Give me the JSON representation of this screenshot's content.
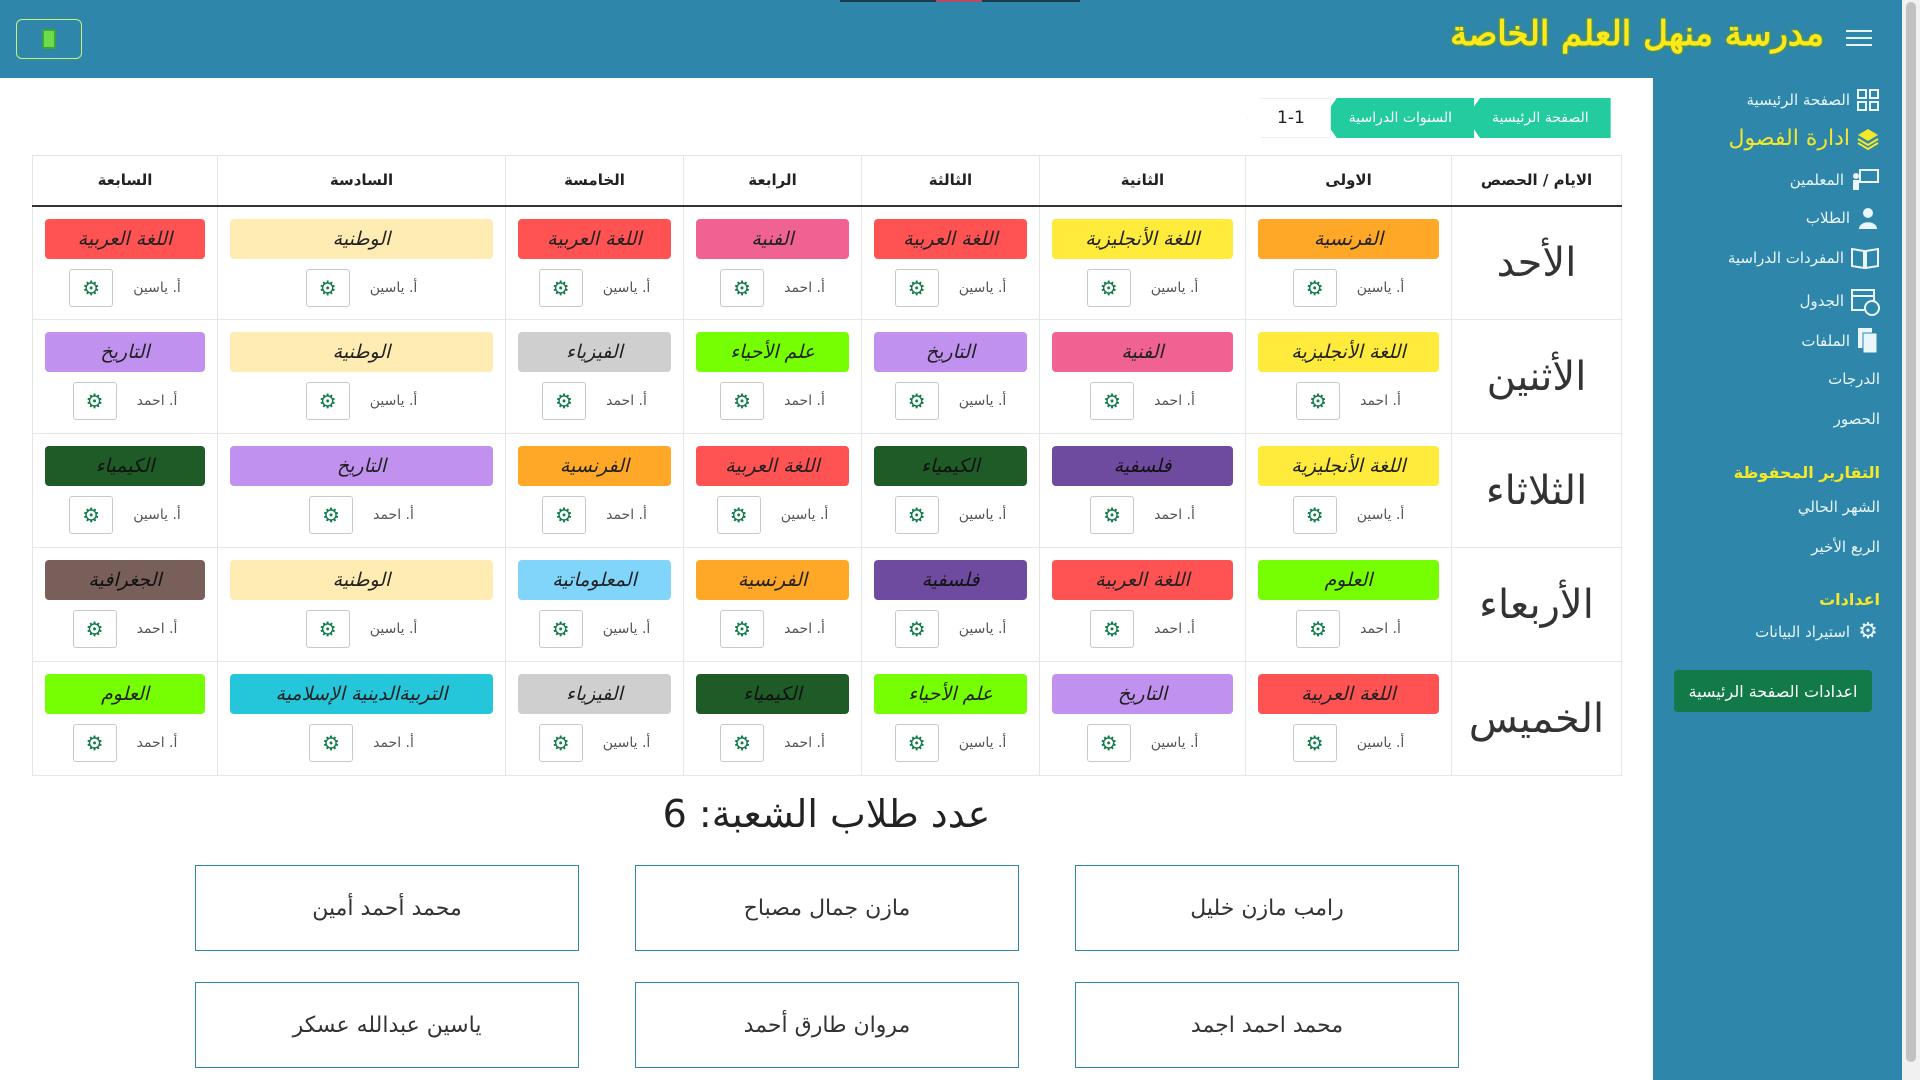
{
  "header": {
    "school_name": "مدرسة منهل العلم الخاصة",
    "exit_icon": "door-exit-icon",
    "menu_icon": "hamburger-icon"
  },
  "sidebar": {
    "items": [
      {
        "label": "الصفحة الرئيسية",
        "icon": "dashboard-icon"
      },
      {
        "label": "ادارة الفصول",
        "icon": "layers-icon"
      },
      {
        "label": "المعلمين",
        "icon": "teacher-icon"
      },
      {
        "label": "الطلاب",
        "icon": "student-icon"
      },
      {
        "label": "المفردات الدراسية",
        "icon": "book-icon"
      },
      {
        "label": "الجدول",
        "icon": "calendar-icon"
      },
      {
        "label": "الملفات",
        "icon": "files-icon"
      },
      {
        "label": "الدرجات",
        "icon": ""
      },
      {
        "label": "الحصور",
        "icon": ""
      }
    ],
    "reports_heading": "التقارير المحفوظة",
    "reports": [
      "الشهر الحالي",
      "الربع الأخير"
    ],
    "settings_heading": "اعدادات",
    "import_label": "استيراد البيانات",
    "home_settings_button": "اعدادات الصفحة الرئيسية"
  },
  "breadcrumb": [
    "الصفحة الرئيسية",
    "السنوات الدراسية",
    "1-1"
  ],
  "table": {
    "corner": "الايام / الحصص",
    "periods": [
      "الاولى",
      "الثانية",
      "الثالثة",
      "الرابعة",
      "الخامسة",
      "السادسة",
      "السابعة"
    ],
    "days": [
      {
        "name": "الأحد",
        "cells": [
          {
            "subject": "الفرنسية",
            "color": "#ffa726",
            "teacher": "أ. ياسين"
          },
          {
            "subject": "اللغة الأنجليزية",
            "color": "#ffeb3b",
            "teacher": "أ. ياسين"
          },
          {
            "subject": "اللغة العربية",
            "color": "#ff5252",
            "teacher": "أ. ياسين"
          },
          {
            "subject": "الفنية",
            "color": "#f06292",
            "teacher": "أ. احمد"
          },
          {
            "subject": "اللغة العربية",
            "color": "#ff5252",
            "teacher": "أ. ياسين"
          },
          {
            "subject": "الوطنية",
            "color": "#ffecb3",
            "teacher": "أ. ياسين"
          },
          {
            "subject": "اللغة العربية",
            "color": "#ff5252",
            "teacher": "أ. ياسين"
          }
        ]
      },
      {
        "name": "الأثنين",
        "cells": [
          {
            "subject": "اللغة الأنجليزية",
            "color": "#ffeb3b",
            "teacher": "أ. احمد"
          },
          {
            "subject": "الفنية",
            "color": "#f06292",
            "teacher": "أ. احمد"
          },
          {
            "subject": "التاريخ",
            "color": "#c191f0",
            "teacher": "أ. ياسين"
          },
          {
            "subject": "علم الأحياء",
            "color": "#76ff03",
            "teacher": "أ. احمد"
          },
          {
            "subject": "الفيزياء",
            "color": "#cfcfcf",
            "teacher": "أ. احمد"
          },
          {
            "subject": "الوطنية",
            "color": "#ffecb3",
            "teacher": "أ. ياسين"
          },
          {
            "subject": "التاريخ",
            "color": "#c191f0",
            "teacher": "أ. احمد"
          }
        ]
      },
      {
        "name": "الثلاثاء",
        "cells": [
          {
            "subject": "اللغة الأنجليزية",
            "color": "#ffeb3b",
            "teacher": "أ. ياسين"
          },
          {
            "subject": "فلسفية",
            "color": "#6f4ba0",
            "teacher": "أ. احمد"
          },
          {
            "subject": "الكيمياء",
            "color": "#1e5b26",
            "teacher": "أ. ياسين"
          },
          {
            "subject": "اللغة العربية",
            "color": "#ff5252",
            "teacher": "أ. ياسين"
          },
          {
            "subject": "الفرنسية",
            "color": "#ffa726",
            "teacher": "أ. احمد"
          },
          {
            "subject": "التاريخ",
            "color": "#c191f0",
            "teacher": "أ. احمد"
          },
          {
            "subject": "الكيمياء",
            "color": "#1e5b26",
            "teacher": "أ. ياسين"
          }
        ]
      },
      {
        "name": "الأربعاء",
        "cells": [
          {
            "subject": "العلوم",
            "color": "#76ff03",
            "teacher": "أ. احمد"
          },
          {
            "subject": "اللغة العربية",
            "color": "#ff5252",
            "teacher": "أ. احمد"
          },
          {
            "subject": "فلسفية",
            "color": "#6f4ba0",
            "teacher": "أ. ياسين"
          },
          {
            "subject": "الفرنسية",
            "color": "#ffa726",
            "teacher": "أ. احمد"
          },
          {
            "subject": "المعلوماتية",
            "color": "#81d4fa",
            "teacher": "أ. ياسين"
          },
          {
            "subject": "الوطنية",
            "color": "#ffecb3",
            "teacher": "أ. ياسين"
          },
          {
            "subject": "الجغرافية",
            "color": "#795f5a",
            "teacher": "أ. احمد"
          }
        ]
      },
      {
        "name": "الخميس",
        "cells": [
          {
            "subject": "اللغة العربية",
            "color": "#ff5252",
            "teacher": "أ. ياسين"
          },
          {
            "subject": "التاريخ",
            "color": "#c191f0",
            "teacher": "أ. ياسين"
          },
          {
            "subject": "علم الأحياء",
            "color": "#76ff03",
            "teacher": "أ. ياسين"
          },
          {
            "subject": "الكيمياء",
            "color": "#1e5b26",
            "teacher": "أ. احمد"
          },
          {
            "subject": "الفيزياء",
            "color": "#cfcfcf",
            "teacher": "أ. ياسين"
          },
          {
            "subject": "التربيةالدينية الإسلامية",
            "color": "#26c6da",
            "teacher": "أ. احمد"
          },
          {
            "subject": "العلوم",
            "color": "#76ff03",
            "teacher": "أ. احمد"
          }
        ]
      }
    ]
  },
  "students": {
    "count_label": "عدد طلاب الشعبة: 6",
    "names": [
      "رامب مازن خليل",
      "مازن جمال مصباح",
      "محمد أحمد أمين",
      "محمد احمد اجمد",
      "مروان طارق أحمد",
      "ياسين عبدالله عسكر"
    ]
  }
}
